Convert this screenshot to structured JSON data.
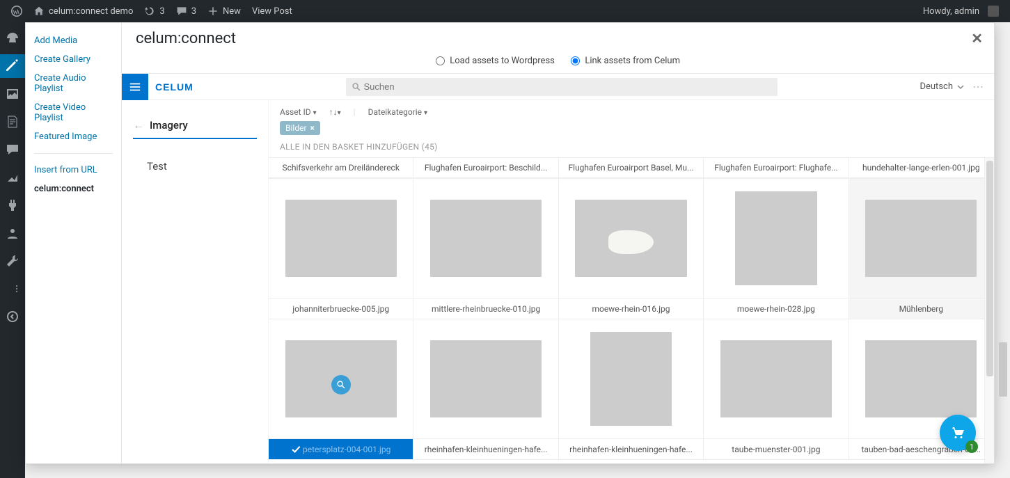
{
  "adminbar": {
    "site_name": "celum:connect demo",
    "updates": "3",
    "comments": "3",
    "new": "New",
    "view_post": "View Post",
    "howdy": "Howdy, admin"
  },
  "media_sidebar": {
    "add_media": "Add Media",
    "create_gallery": "Create Gallery",
    "create_audio": "Create Audio Playlist",
    "create_video": "Create Video Playlist",
    "featured": "Featured Image",
    "insert_url": "Insert from URL",
    "celum": "celum:connect"
  },
  "modal": {
    "title": "celum:connect",
    "close": "✕",
    "radio_load": "Load assets to Wordpress",
    "radio_link": "Link assets from Celum"
  },
  "celum": {
    "search_placeholder": "Suchen",
    "language": "Deutsch",
    "tabs": {
      "imagery": "Imagery",
      "test": "Test"
    },
    "filters": {
      "sort": "Asset ID",
      "category": "Dateikategorie",
      "chip": "Bilder",
      "add_all": "ALLE IN DEN BASKET HINZUFÜGEN (45)"
    },
    "items_row0": [
      "Schifsverkehr am Dreiländereck",
      "Flughafen Euroairport: Beschild...",
      "Flughafen Euroairport Basel, Mu...",
      "Flughafen Euroairport: Flughafe...",
      "hundehalter-lange-erlen-001.jpg"
    ],
    "items_row1": [
      "johanniterbruecke-005.jpg",
      "mittlere-rheinbruecke-010.jpg",
      "moewe-rhein-016.jpg",
      "moewe-rhein-028.jpg",
      "Mühlenberg"
    ],
    "items_row2": [
      "petersplatz-004-001.jpg",
      "rheinhafen-kleinhueningen-hafe...",
      "rheinhafen-kleinhueningen-hafe...",
      "taube-muenster-001.jpg",
      "tauben-bad-aeschengraben-00..."
    ],
    "cart_count": "1"
  }
}
